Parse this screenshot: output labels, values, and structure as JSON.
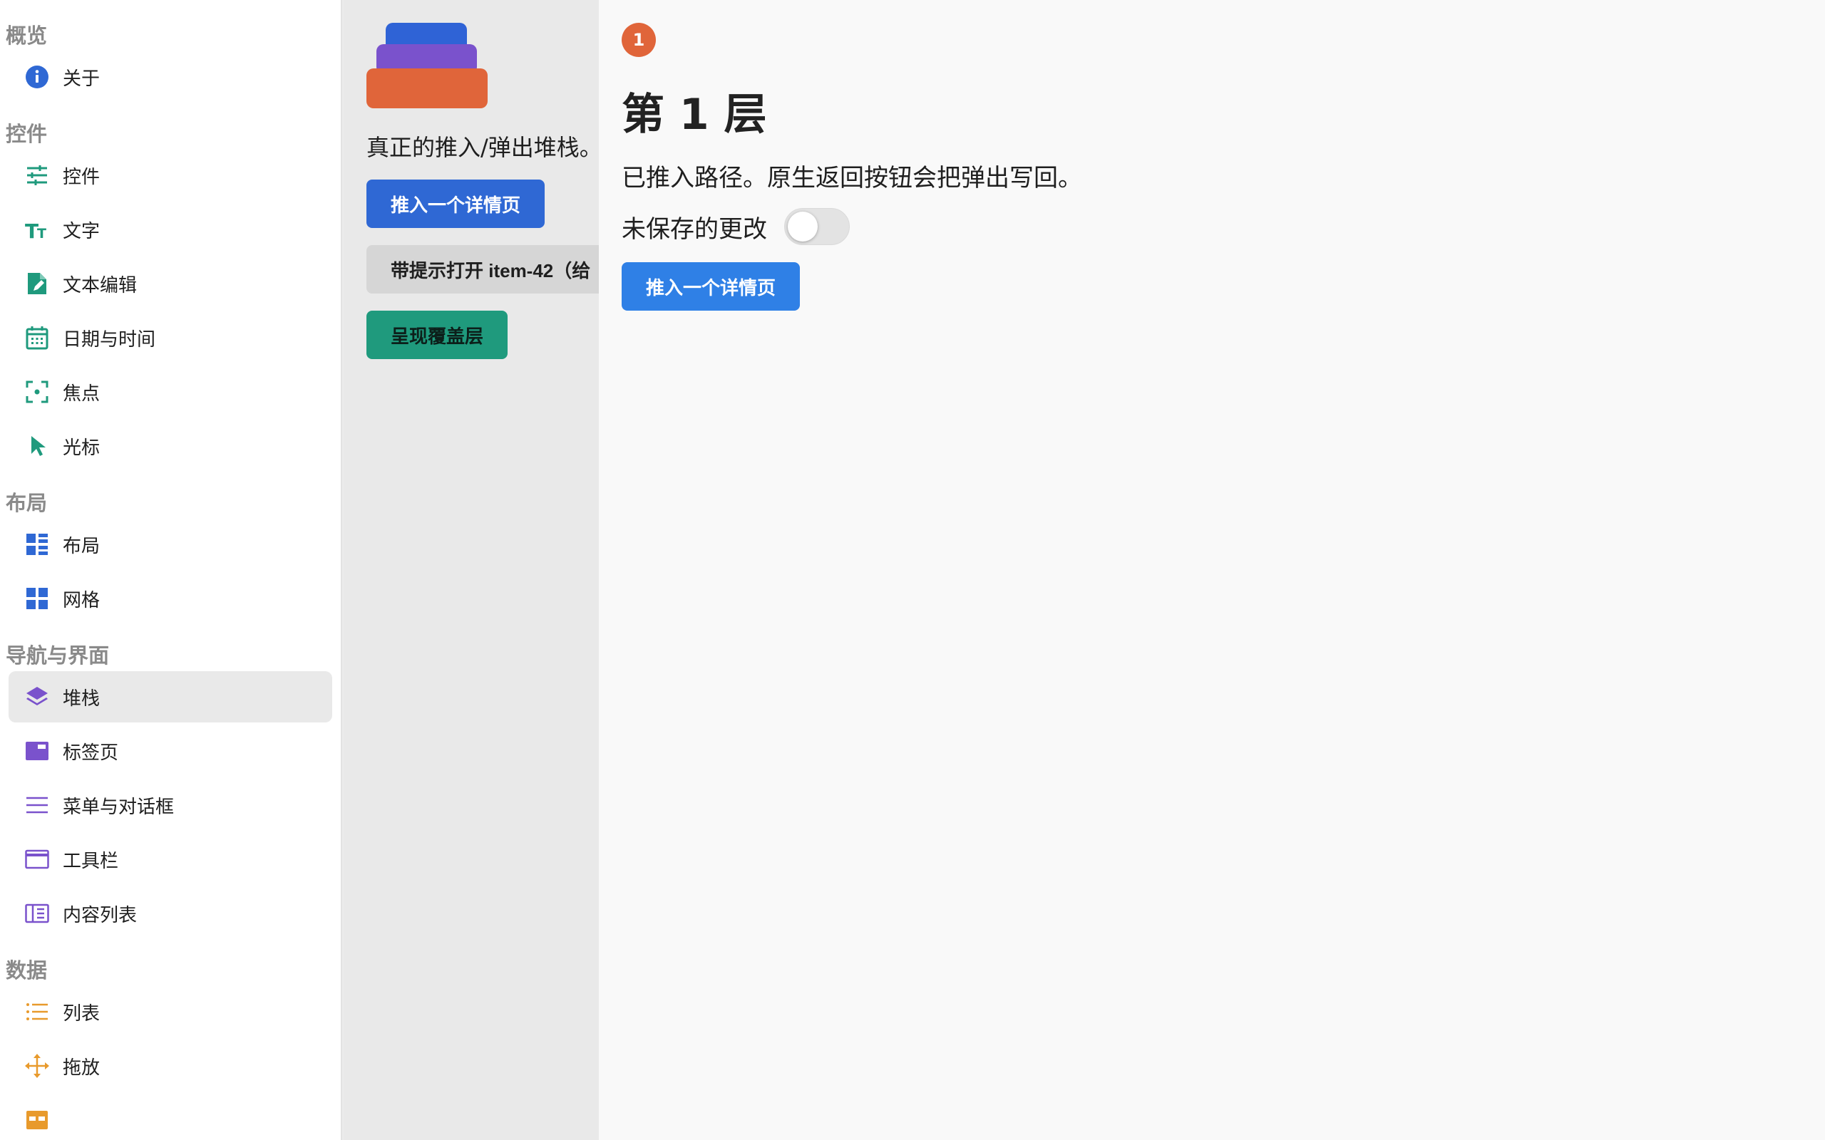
{
  "sidebar": {
    "sections": [
      {
        "title": "概览",
        "items": [
          {
            "label": "关于",
            "icon": "info-icon",
            "color": "#2f68d4"
          }
        ]
      },
      {
        "title": "控件",
        "items": [
          {
            "label": "控件",
            "icon": "sliders-icon",
            "color": "#1f9a7d"
          },
          {
            "label": "文字",
            "icon": "text-size-icon",
            "color": "#1f9a7d"
          },
          {
            "label": "文本编辑",
            "icon": "document-edit-icon",
            "color": "#1f9a7d"
          },
          {
            "label": "日期与时间",
            "icon": "calendar-icon",
            "color": "#1f9a7d"
          },
          {
            "label": "焦点",
            "icon": "focus-icon",
            "color": "#1f9a7d"
          },
          {
            "label": "光标",
            "icon": "cursor-icon",
            "color": "#1f9a7d"
          }
        ]
      },
      {
        "title": "布局",
        "items": [
          {
            "label": "布局",
            "icon": "layout-icon",
            "color": "#2f68d4"
          },
          {
            "label": "网格",
            "icon": "grid-icon",
            "color": "#2f68d4"
          }
        ]
      },
      {
        "title": "导航与界面",
        "items": [
          {
            "label": "堆栈",
            "icon": "layers-icon",
            "color": "#7a52cc",
            "active": true
          },
          {
            "label": "标签页",
            "icon": "tabs-icon",
            "color": "#7a52cc"
          },
          {
            "label": "菜单与对话框",
            "icon": "menu-icon",
            "color": "#7a52cc"
          },
          {
            "label": "工具栏",
            "icon": "toolbar-icon",
            "color": "#7a52cc"
          },
          {
            "label": "内容列表",
            "icon": "content-list-icon",
            "color": "#7a52cc"
          }
        ]
      },
      {
        "title": "数据",
        "items": [
          {
            "label": "列表",
            "icon": "list-icon",
            "color": "#e89a2c"
          },
          {
            "label": "拖放",
            "icon": "move-icon",
            "color": "#e89a2c"
          },
          {
            "label": "",
            "icon": "table-icon",
            "color": "#e89a2c"
          }
        ]
      }
    ]
  },
  "main": {
    "description": "真正的推入/弹出堆栈。",
    "push_button": "推入一个详情页",
    "hint_button": "带提示打开 item-42（给",
    "overlay_button": "呈现覆盖层"
  },
  "detail": {
    "badge": "1",
    "title": "第 1 层",
    "description": "已推入路径。原生返回按钮会把弹出写回。",
    "toggle_label": "未保存的更改",
    "toggle_on": false,
    "push_button": "推入一个详情页"
  }
}
